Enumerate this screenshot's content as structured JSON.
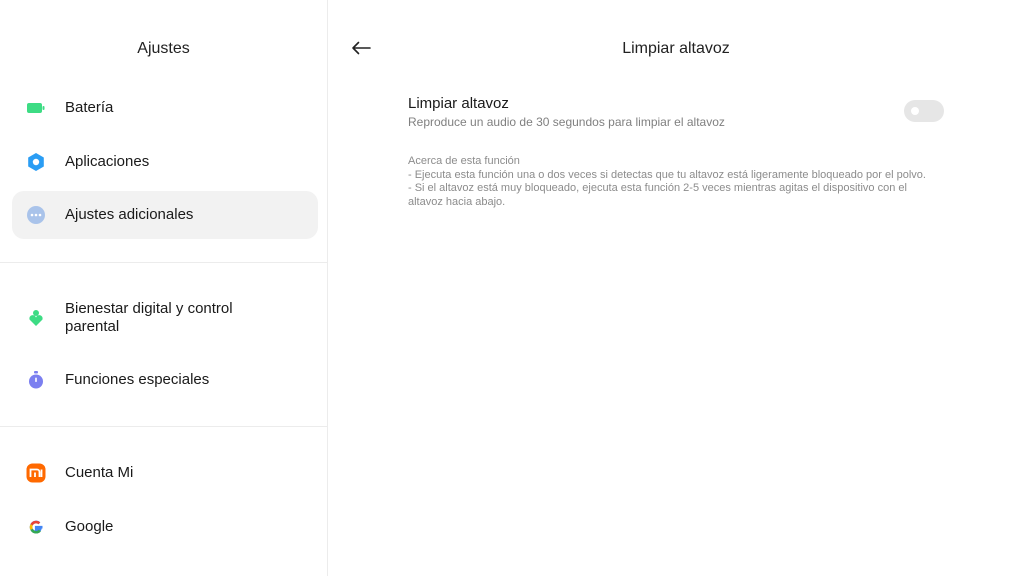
{
  "sidebar": {
    "title": "Ajustes",
    "items": [
      {
        "label": "Batería",
        "icon": "battery-icon",
        "color": "#3ddc84"
      },
      {
        "label": "Aplicaciones",
        "icon": "gear-icon",
        "color": "#2a9df4"
      },
      {
        "label": "Ajustes adicionales",
        "icon": "more-dots-icon",
        "color": "#a9c3ea",
        "active": true
      },
      {
        "label": "Bienestar digital y control parental",
        "icon": "digital-wellbeing-icon",
        "color": "#3ddc84"
      },
      {
        "label": "Funciones especiales",
        "icon": "stopwatch-icon",
        "color": "#7b7ff0"
      },
      {
        "label": "Cuenta Mi",
        "icon": "mi-logo-icon",
        "color": "#ff6900"
      },
      {
        "label": "Google",
        "icon": "google-logo-icon",
        "color": "#4285f4"
      }
    ]
  },
  "main": {
    "back_icon": "back-arrow-icon",
    "title": "Limpiar altavoz",
    "setting": {
      "title": "Limpiar altavoz",
      "subtitle": "Reproduce un audio de 30 segundos para limpiar el altavoz",
      "toggle_on": false
    },
    "about": {
      "heading": "Acerca de esta función",
      "line1": "- Ejecuta esta función una o dos veces si detectas que tu altavoz está ligeramente bloqueado por el polvo.",
      "line2": "- Si el altavoz está muy bloqueado, ejecuta esta función 2-5 veces mientras agitas el dispositivo con el altavoz hacia abajo."
    }
  },
  "colors": {
    "background": "#ffffff",
    "active_item_bg": "#f2f2f2",
    "toggle_off": "#e6e6e6",
    "secondary_text": "#808080"
  }
}
